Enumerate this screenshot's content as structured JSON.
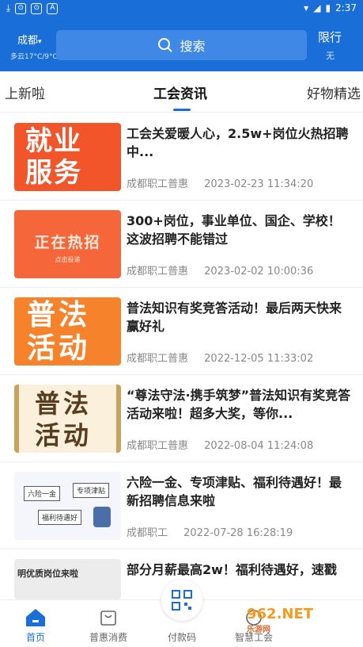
{
  "status_bar": {
    "time": "2:37"
  },
  "header": {
    "city": "成都",
    "weather": "多云17°C/9°C",
    "search_label": "搜索",
    "restrict_label": "限行",
    "restrict_value": "无"
  },
  "tabs": [
    {
      "label": "上新啦"
    },
    {
      "label": "工会资讯"
    },
    {
      "label": "好物精选"
    }
  ],
  "articles": [
    {
      "title": "工会关爱暖人心，2.5w+岗位火热招聘中...",
      "source": "成都职工普惠",
      "time": "2023-02-23 11:34:20",
      "thumb_l1": "就业",
      "thumb_l2": "服务"
    },
    {
      "title": "300+岗位，事业单位、国企、学校！这波招聘不能错过",
      "source": "成都职工普惠",
      "time": "2023-02-02 10:00:36",
      "thumb_l1": "正在热招",
      "thumb_l2": "点击投递"
    },
    {
      "title": "普法知识有奖竞答活动！最后两天快来赢好礼",
      "source": "成都职工普惠",
      "time": "2022-12-05 11:33:02",
      "thumb_l1": "普法",
      "thumb_l2": "活动"
    },
    {
      "title": "“尊法守法·携手筑梦”普法知识有奖竞答活动来啦！超多大奖，等你...",
      "source": "成都职工普惠",
      "time": "2022-08-04 11:24:08",
      "thumb_l1": "普法",
      "thumb_l2": "活动"
    },
    {
      "title": "六险一金、专项津贴、福利待遇好！最新招聘信息来啦",
      "source": "成都职工",
      "time": "2022-07-28 16:28:19",
      "thumb_l1": "六险一金",
      "thumb_l2": "专项津贴",
      "thumb_l3": "福利待遇好"
    },
    {
      "title": "部分月薪最高2w！福利待遇好，速戳",
      "thumb_l1": "明优质岗位来啦"
    }
  ],
  "bottom_nav": [
    {
      "label": "首页"
    },
    {
      "label": "普惠消费"
    },
    {
      "label": "付款码"
    },
    {
      "label": "智慧工会"
    }
  ],
  "watermark": {
    "main": "962.NET",
    "sub": "乐游网"
  },
  "colors": {
    "primary": "#1a6ed8",
    "text": "#222222",
    "muted": "#888888"
  }
}
